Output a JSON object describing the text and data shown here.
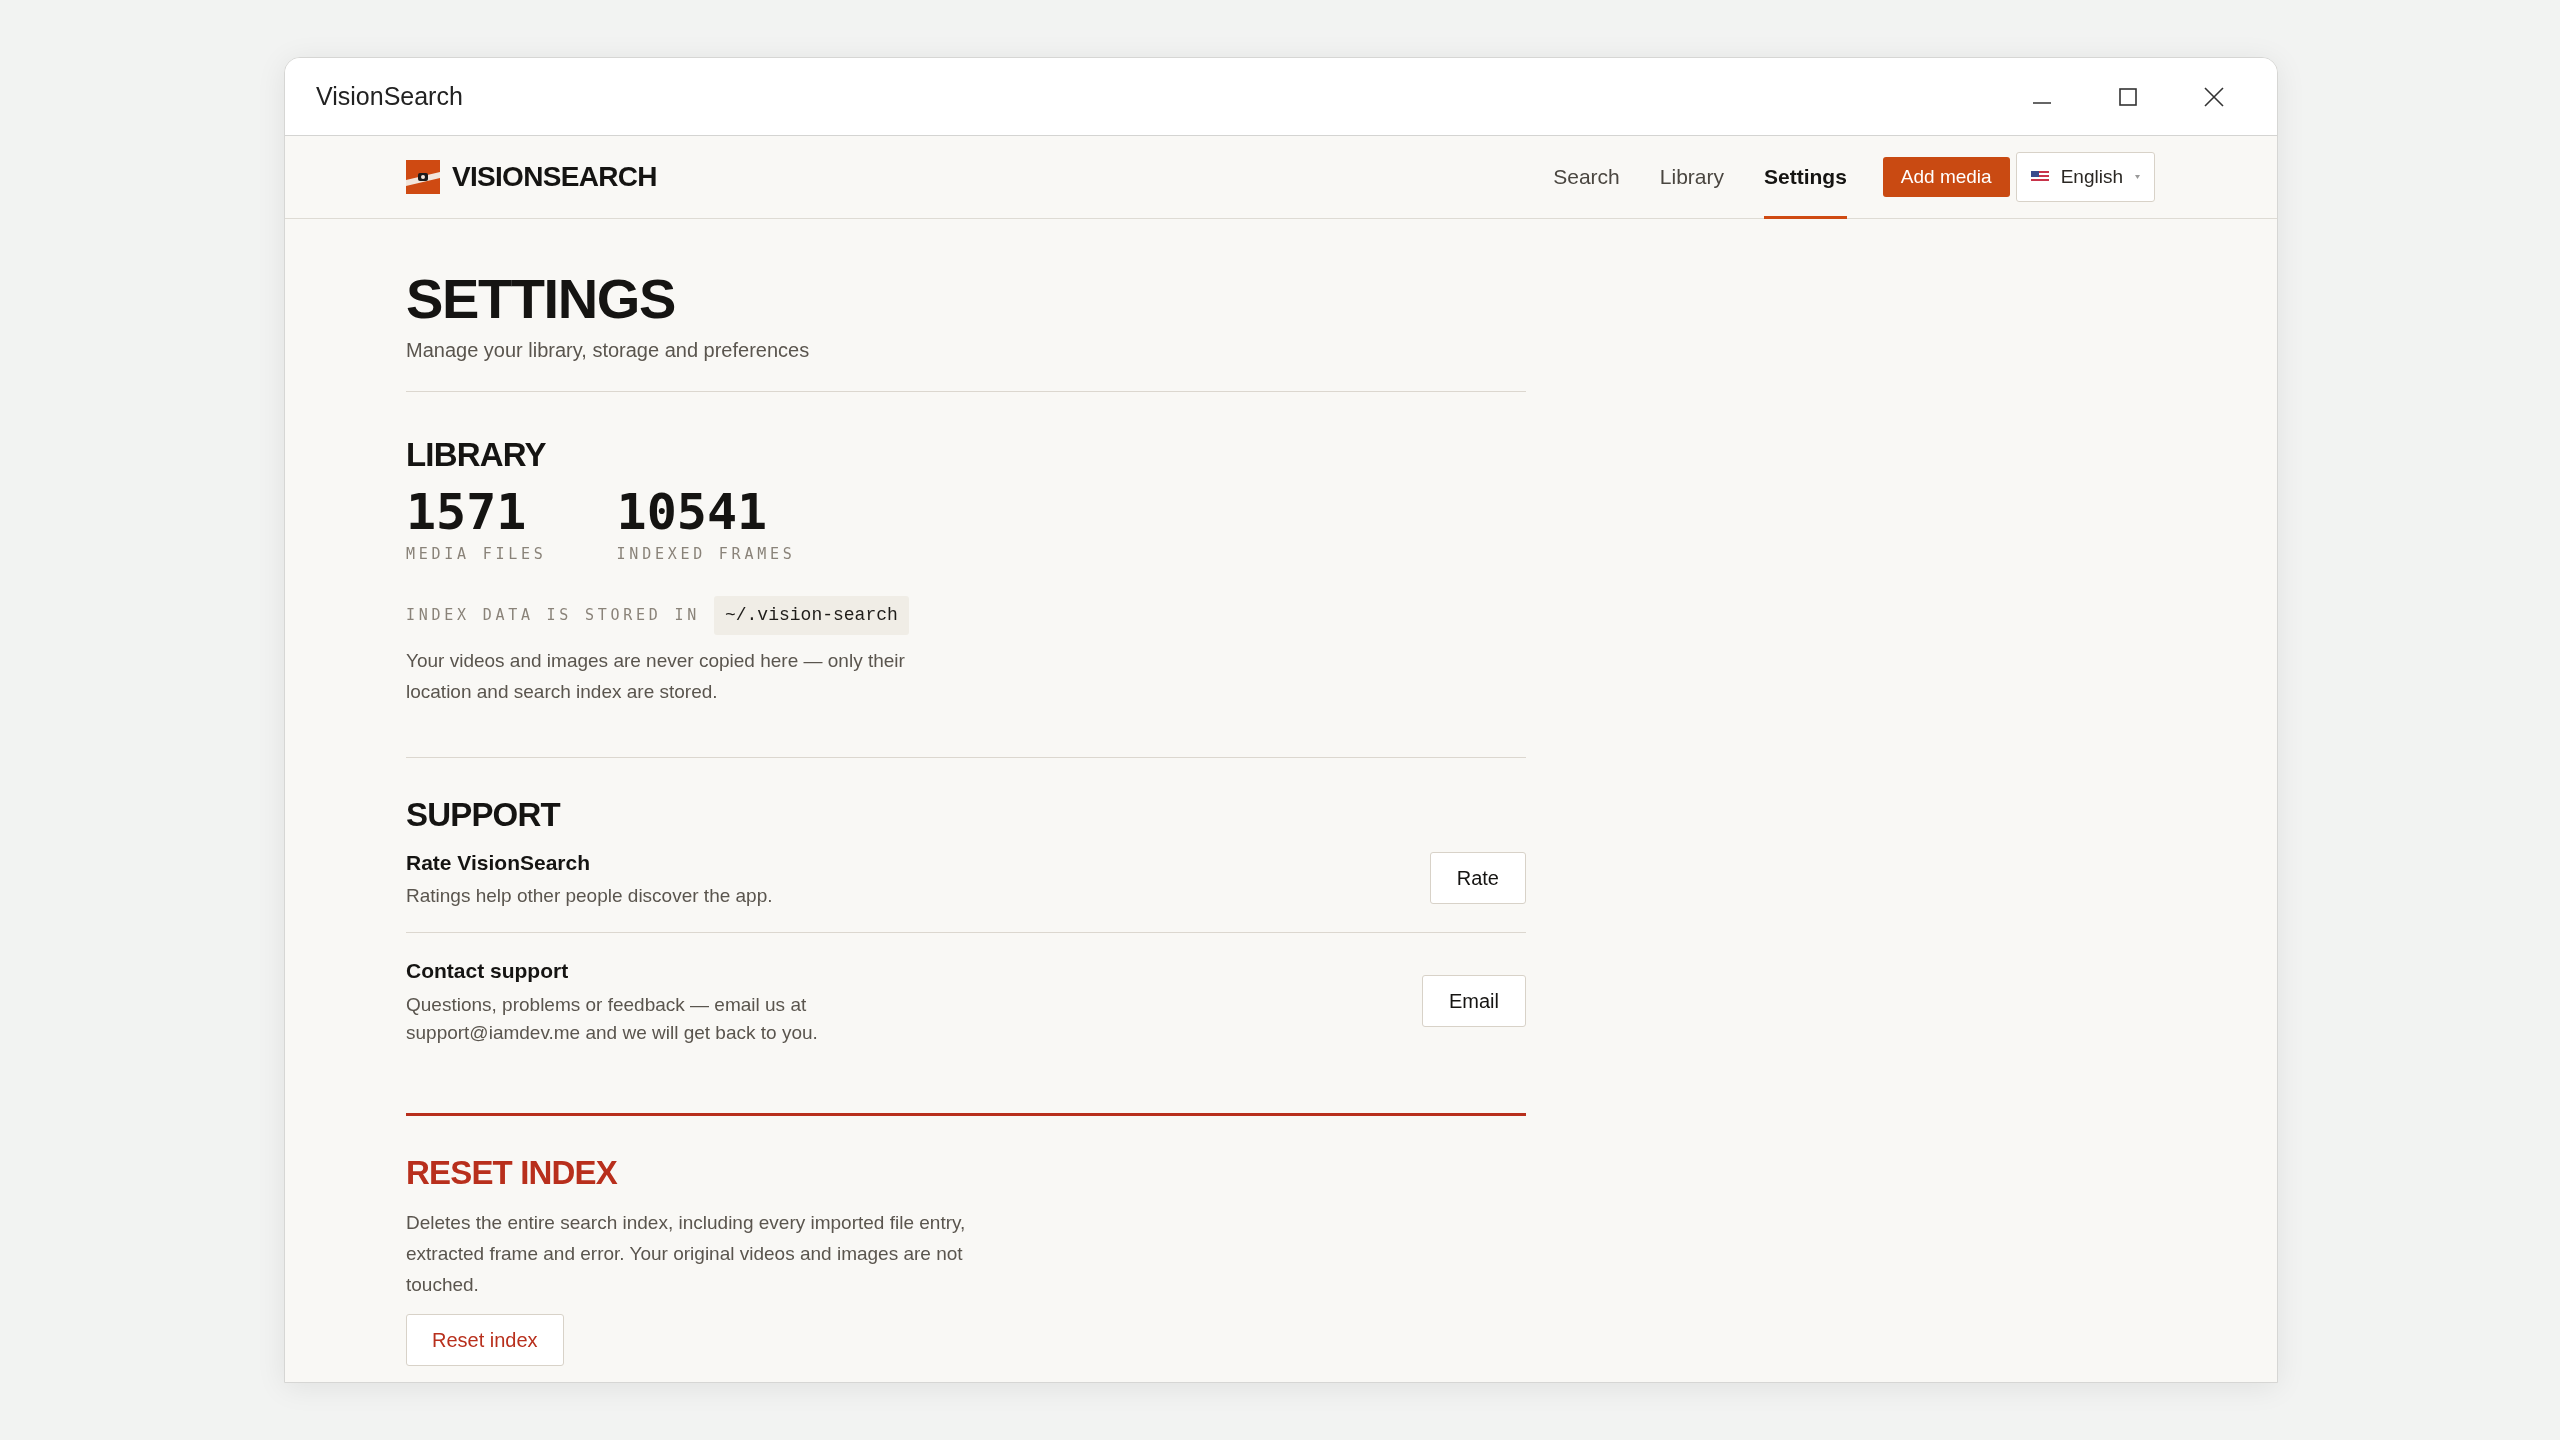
{
  "window": {
    "title": "VisionSearch"
  },
  "header": {
    "brand": "VISIONSEARCH",
    "nav": [
      {
        "label": "Search",
        "selected": false
      },
      {
        "label": "Library",
        "selected": false
      },
      {
        "label": "Settings",
        "selected": true
      }
    ],
    "add_button": "Add media",
    "language": "English"
  },
  "page": {
    "title": "SETTINGS",
    "subtitle": "Manage your library, storage and preferences"
  },
  "library": {
    "heading": "LIBRARY",
    "stats": [
      {
        "value": "1571",
        "label": "MEDIA FILES"
      },
      {
        "value": "10541",
        "label": "INDEXED FRAMES"
      }
    ],
    "storage_label": "INDEX DATA IS STORED IN",
    "storage_path": "~/.vision-search",
    "note": "Your videos and images are never copied here — only their location and search index are stored."
  },
  "support": {
    "heading": "SUPPORT",
    "items": [
      {
        "title": "Rate VisionSearch",
        "description": "Ratings help other people discover the app.",
        "button": "Rate"
      },
      {
        "title": "Contact support",
        "description": "Questions, problems or feedback — email us at support@iamdev.me and we will get back to you.",
        "button": "Email"
      }
    ]
  },
  "reset": {
    "heading": "RESET INDEX",
    "description": "Deletes the entire search index, including every imported file entry, extracted frame and error. Your original videos and images are not touched.",
    "button": "Reset index"
  }
}
